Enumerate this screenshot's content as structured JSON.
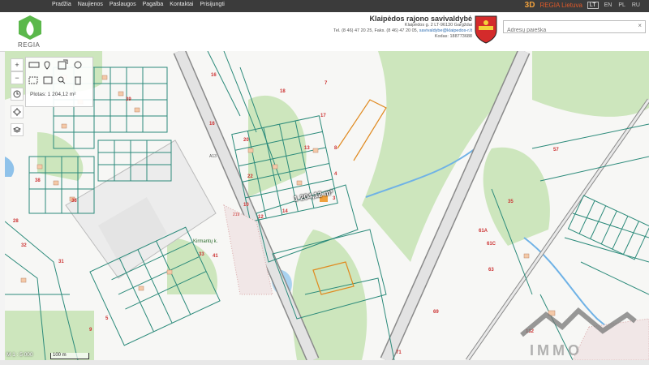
{
  "nav": {
    "links": [
      "Pradžia",
      "Naujienos",
      "Paslaugos",
      "Pagalba",
      "Kontaktai",
      "Prisijungti"
    ],
    "btn_3d": "3D",
    "regia_lietuva": "REGIA Lietuva",
    "langs": [
      "LT",
      "EN",
      "PL",
      "RU"
    ],
    "active_lang": "LT"
  },
  "header": {
    "logo_text": "REGIA",
    "municipality": "Klaipėdos rajono savivaldybė",
    "address": "Klaipėdos g. 2 LT-96130 Gargždai",
    "phone": "Tel. (8 46) 47 20 25, Faks. (8 46) 47 20 05,",
    "email": "savivaldybe@klaipedos-r.lt",
    "code": "Kodas: 188773688",
    "search_placeholder": "Adresų paieška",
    "search_clear": "×"
  },
  "tools": {
    "zoom_in": "+",
    "zoom_out": "−",
    "area_label": "Plotas: 1 204,12 m²",
    "measure_label": "1 204,12 m²"
  },
  "map_labels": {
    "highway": "A13",
    "road_sign": "219",
    "street_kirmantu": "Kirmantų k.",
    "parcels": [
      "16",
      "16",
      "20",
      "22",
      "10",
      "12",
      "14",
      "18",
      "13",
      "17",
      "7",
      "4",
      "31",
      "9",
      "5",
      "57",
      "35",
      "61A",
      "61C",
      "63",
      "69",
      "71",
      "132",
      "39",
      "41",
      "33",
      "36",
      "38",
      "32",
      "28",
      "3",
      "8"
    ]
  },
  "scale": {
    "ratio": "M 1 : 5 000",
    "bar": "100 m"
  },
  "colors": {
    "nav_bg": "#3b3b3b",
    "accent_orange": "#f0a03c",
    "parcel_line": "#2b8a7a",
    "green_area": "#cfe8bf",
    "road": "#cfcfcf"
  }
}
